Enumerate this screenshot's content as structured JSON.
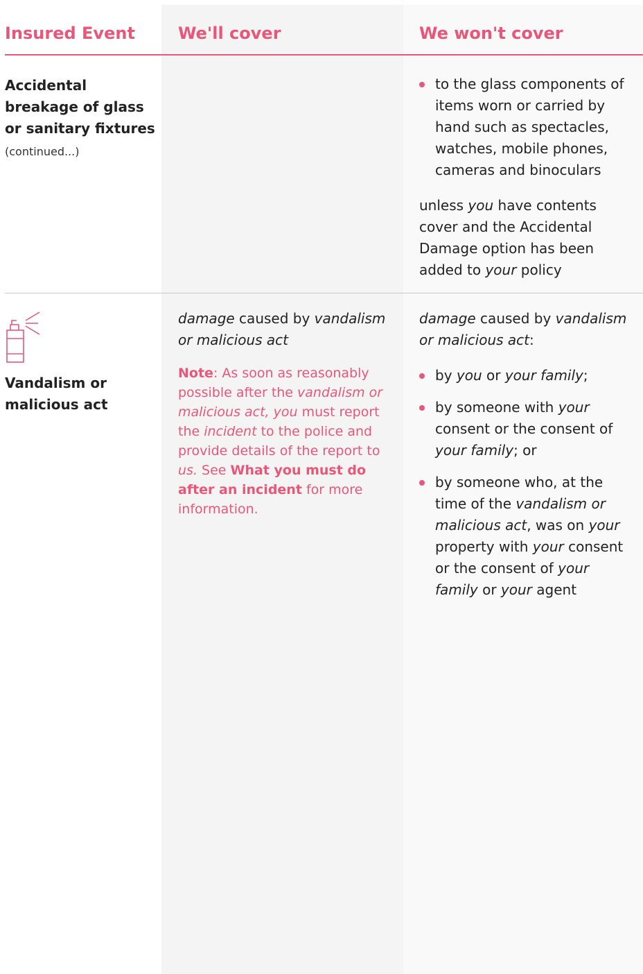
{
  "headers": {
    "insured_event": "Insured Event",
    "well_cover": "We'll cover",
    "we_wont_cover": "We won't cover"
  },
  "rows": [
    {
      "event_title": "Accidental breakage of glass or sanitary fixtures",
      "event_note": "(continued...)",
      "wont_cover_items": [
        "to the glass components of items worn or carried by hand such as spectacles, watches, mobile phones, cameras and binoculars"
      ],
      "wont_cover_tail": [
        "unless ",
        "you",
        " have contents cover and the Accidental Damage option has been added to ",
        "your",
        " policy"
      ]
    },
    {
      "icon": "spray-can-icon",
      "event_title": "Vandalism or malicious act",
      "cover_intro": [
        "damage",
        " caused by ",
        "vandalism or malicious act"
      ],
      "cover_note": [
        "Note",
        ": As soon as reasonably possible after the ",
        "vandalism or malicious act, you",
        " must report the ",
        "incident",
        " to the police and provide details of the report to ",
        "us.",
        " See ",
        "What you must do after an incident",
        " for more information."
      ],
      "wont_cover_intro": [
        "damage",
        " caused by ",
        "vandalism or malicious act",
        ":"
      ],
      "wont_cover_items": [
        [
          "by ",
          "you",
          " or ",
          "your family",
          ";"
        ],
        [
          "by someone with ",
          "your",
          " consent or the consent of ",
          "your family",
          "; or"
        ],
        [
          "by someone who, at the time of the ",
          "vandalism or malicious act",
          ", was on ",
          "your",
          " property with ",
          "your",
          " consent or the consent of ",
          "your family",
          " or ",
          "your",
          " agent"
        ]
      ]
    }
  ],
  "colors": {
    "accent": "#e8577a",
    "rule": "#c8c8c8",
    "col_bg": "#f4f4f4"
  }
}
